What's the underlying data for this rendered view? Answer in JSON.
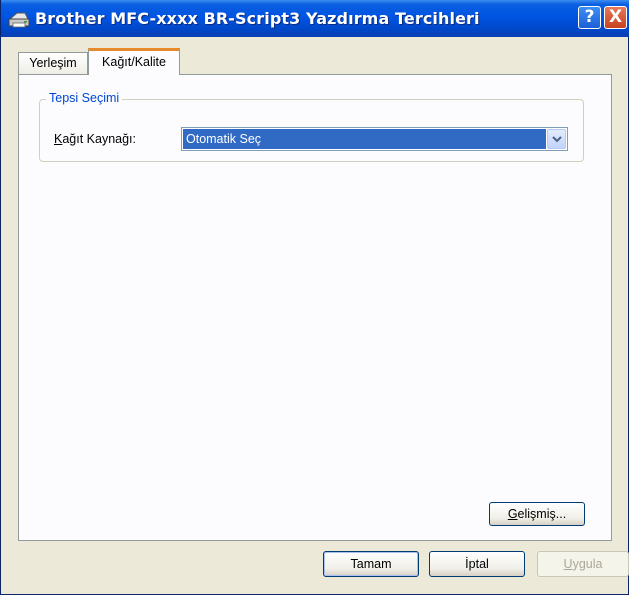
{
  "window": {
    "title": "Brother MFC-xxxx BR-Script3 Yazdırma Tercihleri",
    "help_button": "?",
    "close_button": "X"
  },
  "tabs": [
    {
      "label": "Yerleşim",
      "selected": false
    },
    {
      "label": "Kağıt/Kalite",
      "selected": true
    }
  ],
  "tray_group": {
    "title": "Tepsi Seçimi",
    "paper_source_label_accel": "K",
    "paper_source_label_rest": "ağıt Kaynağı:",
    "paper_source_value": "Otomatik Seç"
  },
  "advanced_button": {
    "accel": "G",
    "rest": "elişmiş..."
  },
  "footer": {
    "ok_label": "Tamam",
    "cancel_label": "İptal",
    "apply_accel": "U",
    "apply_rest": "ygula"
  },
  "colors": {
    "titlebar": "#0054e3",
    "tab_accent": "#e68b2c",
    "group_title": "#0046d5",
    "selection": "#316ac5"
  },
  "icons": [
    "printer-icon",
    "help-icon",
    "close-icon",
    "dropdown-arrow-icon"
  ]
}
